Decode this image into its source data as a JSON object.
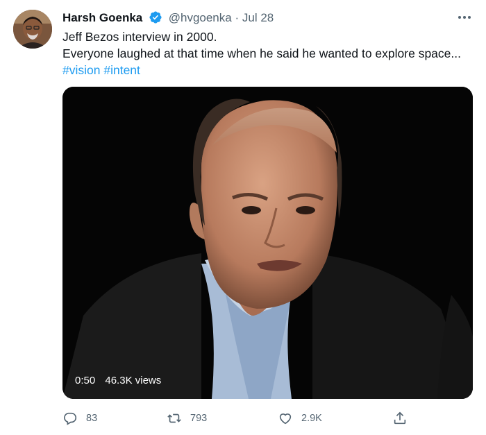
{
  "author": {
    "display_name": "Harsh Goenka",
    "handle": "@hvgoenka",
    "separator": "·",
    "date": "Jul 28",
    "verified_icon": "verified-badge-icon",
    "avatar_icon": "avatar"
  },
  "tweet": {
    "line1": "Jeff Bezos interview in 2000.",
    "line2": "Everyone laughed at that time when he said he wanted to explore space...",
    "hashtags": [
      "#vision",
      "#intent"
    ]
  },
  "video": {
    "duration": "0:50",
    "views": "46.3K views"
  },
  "actions": {
    "reply_count": "83",
    "retweet_count": "793",
    "like_count": "2.9K",
    "share_icon": "share-icon"
  },
  "colors": {
    "accent": "#1d9bf0",
    "secondary_text": "#536471",
    "primary_text": "#0f1419"
  }
}
